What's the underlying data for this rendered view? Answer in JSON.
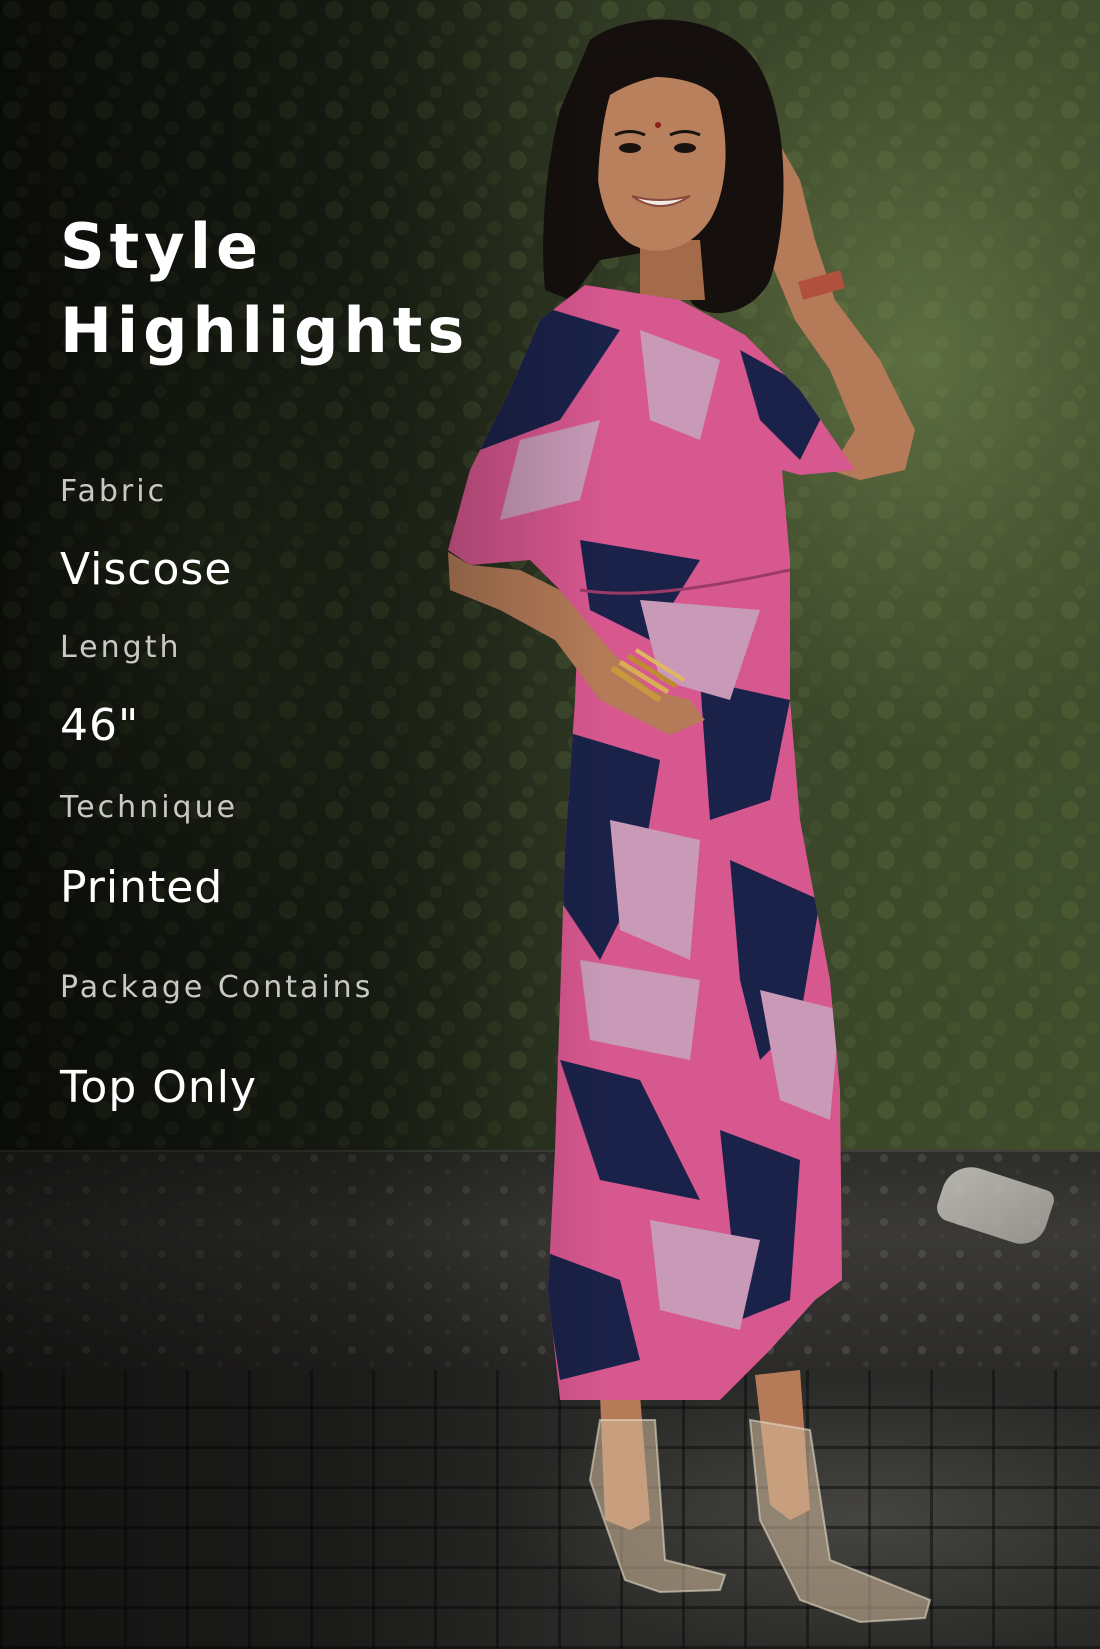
{
  "title": "Style Highlights",
  "specs": [
    {
      "label": "Fabric",
      "value": "Viscose"
    },
    {
      "label": "Length",
      "value": "46\""
    },
    {
      "label": "Technique",
      "value": "Printed"
    },
    {
      "label": "Package Contains",
      "value": "Top Only"
    }
  ],
  "colors": {
    "dress_pink": "#d7578f",
    "dress_navy": "#1b2249",
    "dress_lilac": "#c89ab8",
    "skin": "#b57b58",
    "hair": "#15100d"
  }
}
